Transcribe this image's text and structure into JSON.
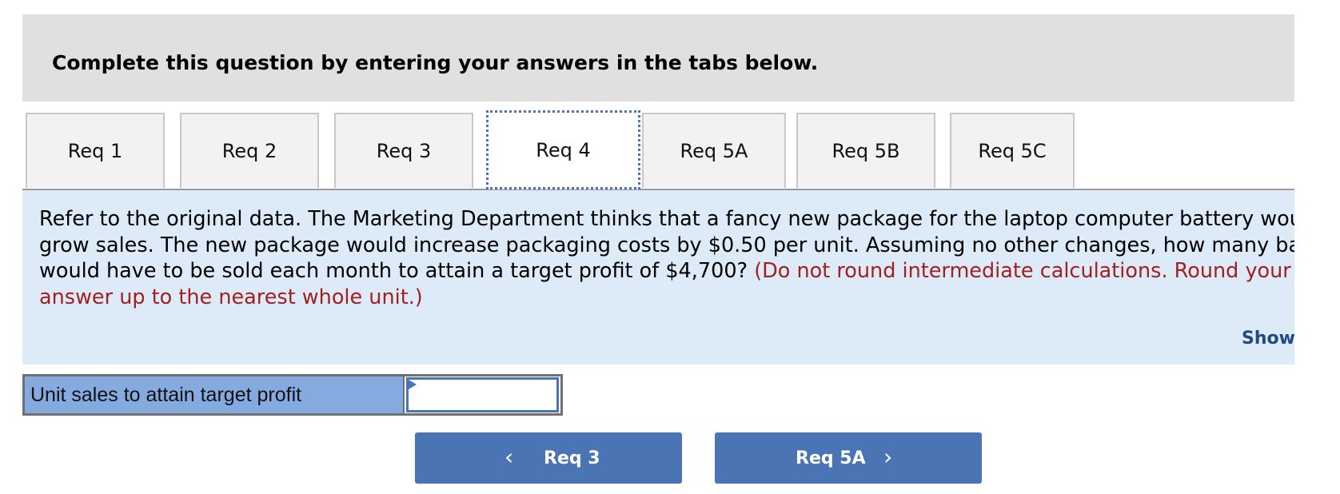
{
  "header": {
    "instruction": "Complete this question by entering your answers in the tabs below."
  },
  "tabs": [
    {
      "label": "Req 1",
      "active": false
    },
    {
      "label": "Req 2",
      "active": false
    },
    {
      "label": "Req 3",
      "active": false
    },
    {
      "label": "Req 4",
      "active": true
    },
    {
      "label": "Req 5A",
      "active": false
    },
    {
      "label": "Req 5B",
      "active": false
    },
    {
      "label": "Req 5C",
      "active": false
    }
  ],
  "question": {
    "line1": "Refer to the original data. The Marketing Department thinks that a fancy new package for the laptop computer battery would",
    "line2": "grow sales. The new package would increase packaging costs by $0.50 per unit. Assuming no other changes, how many batteries",
    "line3_black": "would have to be sold each month to attain a target profit of $4,700? ",
    "line3_red": "(Do not round intermediate calculations. Round your",
    "line4_red": "answer up to the nearest whole unit.)",
    "show_link": "Show less"
  },
  "answer": {
    "label": "Unit sales to attain target profit",
    "value": "",
    "placeholder": ""
  },
  "navigation": {
    "prev_label": "Req 3",
    "next_label": "Req 5A",
    "prev_icon": "chevron-left-icon",
    "next_icon": "chevron-right-icon"
  },
  "colors": {
    "header_bg": "#e0e0e0",
    "content_bg": "#ddeaf7",
    "instruction_red": "#a32020",
    "label_cell_bg": "#84aae0",
    "nav_button_bg": "#4a74b3",
    "active_tab_border": "#4a74b4",
    "link_color": "#23497e"
  }
}
